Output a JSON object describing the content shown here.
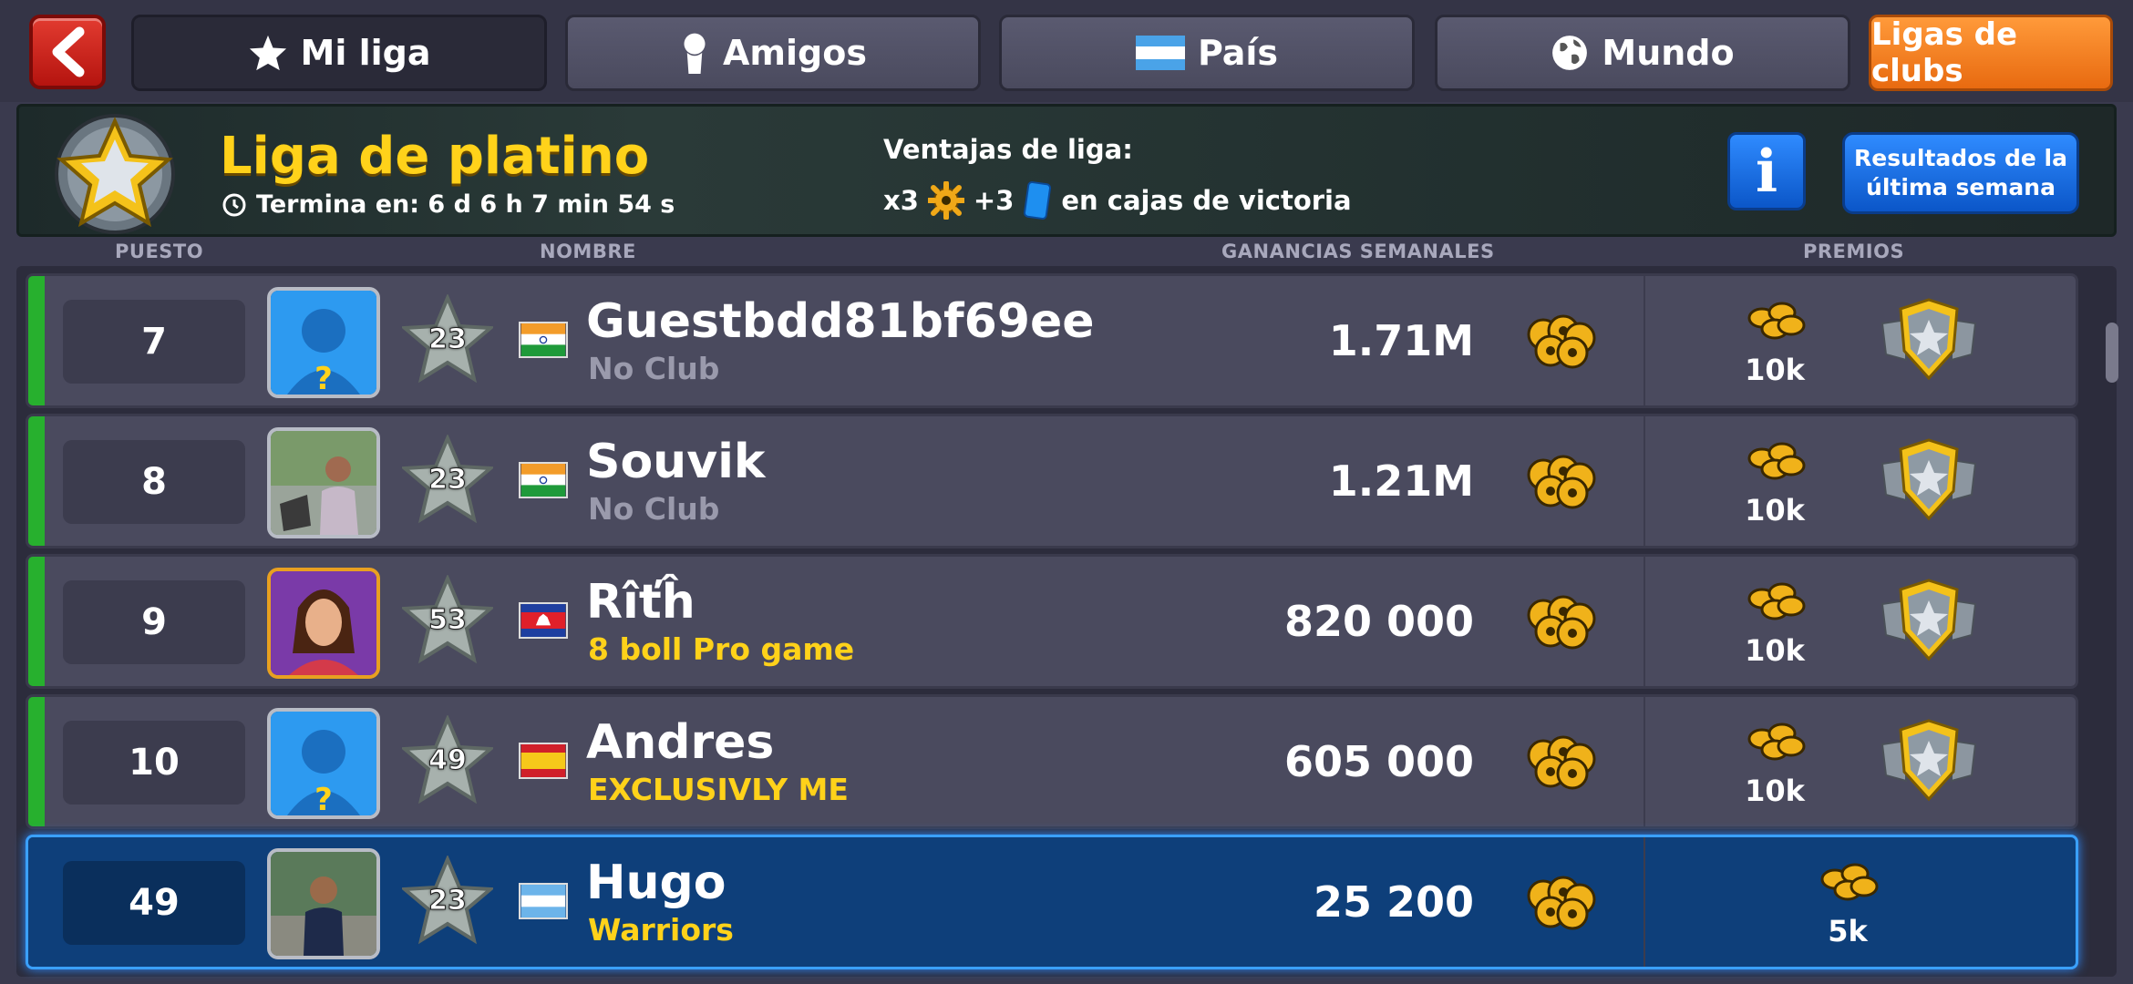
{
  "nav": {
    "tabs": [
      {
        "label": "Mi liga",
        "icon": "star-icon",
        "active": true
      },
      {
        "label": "Amigos",
        "icon": "person-icon",
        "active": false
      },
      {
        "label": "País",
        "icon": "flag-icon",
        "active": false
      },
      {
        "label": "Mundo",
        "icon": "globe-icon",
        "active": false
      },
      {
        "label": "Ligas de clubs",
        "icon": "",
        "active": false
      }
    ]
  },
  "league": {
    "name": "Liga de platino",
    "ends_label": "Termina en: 6 d 6 h 7 min 54 s",
    "perks_title": "Ventajas de liga:",
    "perk_multiplier": "x3",
    "perk_cards": "+3",
    "perk_text": "en cajas de victoria",
    "info_label": "i",
    "results_label": "Resultados de la última semana"
  },
  "columns": {
    "rank": "PUESTO",
    "name": "NOMBRE",
    "earnings": "GANANCIAS SEMANALES",
    "prizes": "PREMIOS"
  },
  "rows": [
    {
      "rank": "7",
      "level": "23",
      "name": "Guestbdd81bf69ee",
      "club": "No Club",
      "earnings": "1.71M",
      "prize": "10k",
      "flag": "india",
      "avatar": "default"
    },
    {
      "rank": "8",
      "level": "23",
      "name": "Souvik",
      "club": "No Club",
      "earnings": "1.21M",
      "prize": "10k",
      "flag": "india",
      "avatar": "photo"
    },
    {
      "rank": "9",
      "level": "53",
      "name": "Rîťĥ",
      "club": "8 boll Pro game",
      "earnings": "820 000",
      "prize": "10k",
      "flag": "cambodia",
      "avatar": "character"
    },
    {
      "rank": "10",
      "level": "49",
      "name": "Andres",
      "club": "EXCLUSIVLY ME",
      "earnings": "605 000",
      "prize": "10k",
      "flag": "spain",
      "avatar": "default"
    },
    {
      "rank": "49",
      "level": "23",
      "name": "Hugo",
      "club": "Warriors",
      "earnings": "25 200",
      "prize": "5k",
      "flag": "argentina",
      "avatar": "photo"
    }
  ],
  "colors": {
    "league_gold": "#ffd21a",
    "promo_green": "#27b02e",
    "self_highlight": "#0e3f7a",
    "clubs_orange": "#ff9a3a"
  }
}
